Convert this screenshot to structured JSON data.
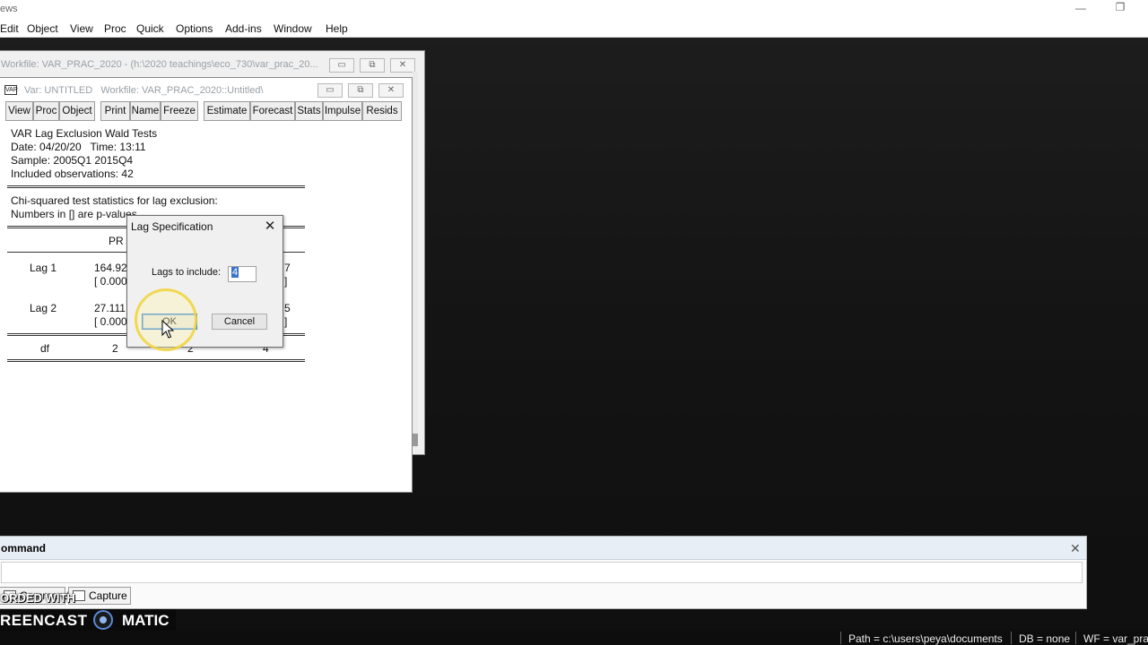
{
  "app": {
    "title": "ews",
    "minimize_glyph": "—",
    "restore_glyph": "❐"
  },
  "menubar": {
    "items": [
      "Edit",
      "Object",
      "View",
      "Proc",
      "Quick",
      "Options",
      "Add-ins",
      "Window",
      "Help"
    ]
  },
  "workfile_window": {
    "title": "Workfile: VAR_PRAC_2020 - (h:\\2020 teachings\\eco_730\\var_prac_20..."
  },
  "var_window": {
    "icon_label": "VAR",
    "title": "Var: UNTITLED   Workfile: VAR_PRAC_2020::Untitled\\",
    "toolbar": [
      "View",
      "Proc",
      "Object",
      "Print",
      "Name",
      "Freeze",
      "Estimate",
      "Forecast",
      "Stats",
      "Impulse",
      "Resids"
    ],
    "output": {
      "heading_lines": [
        "VAR Lag Exclusion Wald Tests",
        "Date: 04/20/20   Time: 13:11",
        "Sample: 2005Q1 2015Q4",
        "Included observations: 42"
      ],
      "note_lines": [
        "Chi-squared test statistics for lag exclusion:",
        "Numbers in [] are p-values"
      ],
      "column_header": "PR",
      "rows": [
        {
          "label": "Lag 1",
          "stat": "164.92",
          "pval": "[ 0.000",
          "tail_stat": "7",
          "tail_pval": "]"
        },
        {
          "label": "Lag 2",
          "stat": "27.111",
          "pval": "[ 0.000",
          "tail_stat": "5",
          "tail_pval": "]"
        }
      ],
      "df_row": {
        "label": "df",
        "v1": "2",
        "v2": "2",
        "v3": "4"
      }
    }
  },
  "dialog": {
    "title": "Lag Specification",
    "close_glyph": "✕",
    "field_label": "Lags to include:",
    "field_value": "4",
    "ok_label": "OK",
    "cancel_label": "Cancel"
  },
  "command_pane": {
    "title": "ommand",
    "close_glyph": "✕",
    "tabs": [
      "Command",
      "Capture"
    ]
  },
  "watermark": {
    "top_text": "ORDED WITH",
    "left_word": "REENCAST",
    "right_word": "MATIC"
  },
  "statusbar": {
    "path": "Path = c:\\users\\peya\\documents",
    "db": "DB = none",
    "wf": "WF = var_prac"
  }
}
